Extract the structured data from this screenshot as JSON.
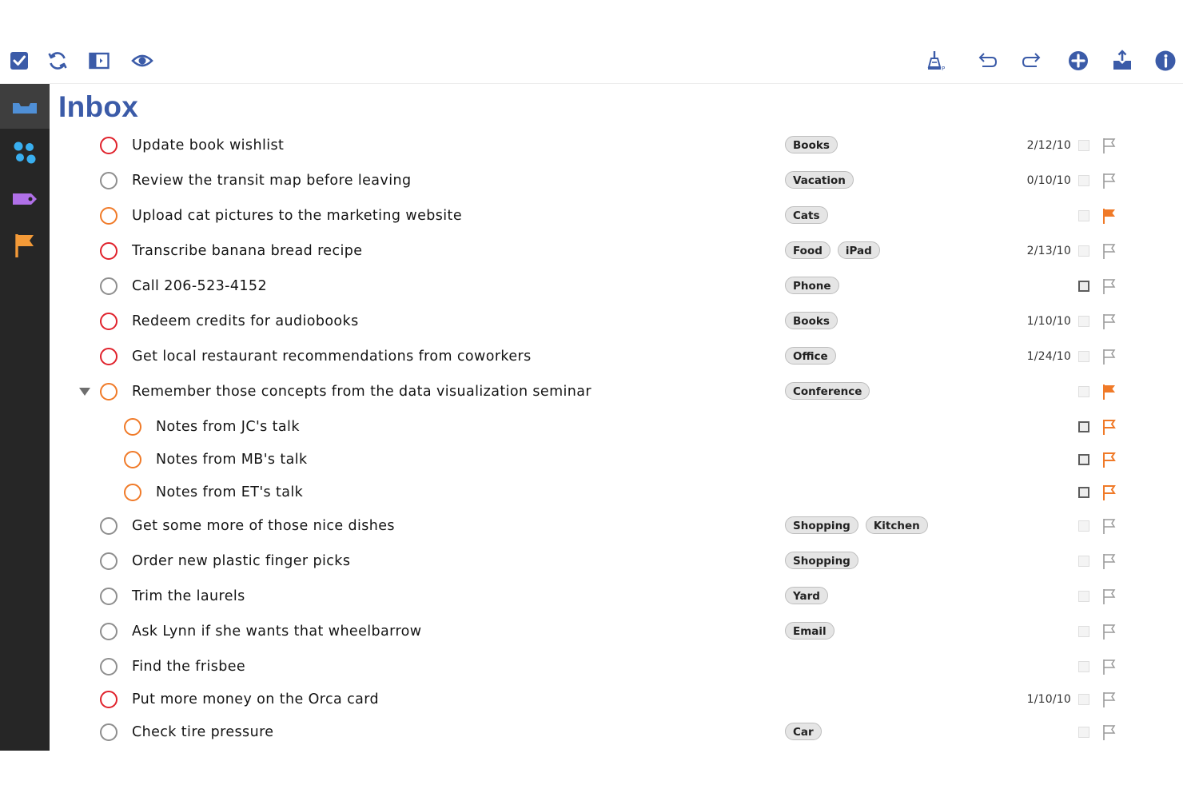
{
  "colors": {
    "accent": "#3b5ba8",
    "sidebar_bg": "#262626",
    "red": "#e0222c",
    "orange": "#f07a28",
    "gray": "#8e8e8e"
  },
  "toolbar": {
    "left_icons": [
      "checkbox-icon",
      "sync-icon",
      "sidebar-toggle-icon",
      "eye-icon"
    ],
    "right_icons": [
      "cleanup-icon",
      "undo-icon",
      "redo-icon",
      "add-icon",
      "share-icon",
      "info-icon"
    ]
  },
  "sidebar": {
    "items": [
      {
        "icon": "inbox-icon",
        "active": true
      },
      {
        "icon": "projects-icon",
        "active": false
      },
      {
        "icon": "tag-icon",
        "active": false
      },
      {
        "icon": "flag-icon",
        "active": false
      }
    ]
  },
  "main": {
    "title": "Inbox",
    "tasks": [
      {
        "text": "Update book wishlist",
        "status": "red",
        "tags": [
          "Books"
        ],
        "date": "2/12/10",
        "selector": "faint",
        "flag": "empty"
      },
      {
        "text": "Review the transit map before leaving",
        "status": "gray",
        "tags": [
          "Vacation"
        ],
        "date": "0/10/10",
        "selector": "faint",
        "flag": "empty"
      },
      {
        "text": "Upload cat pictures to the marketing website",
        "status": "orange",
        "tags": [
          "Cats"
        ],
        "date": "",
        "selector": "faint",
        "flag": "filled"
      },
      {
        "text": "Transcribe banana bread recipe",
        "status": "red",
        "tags": [
          "Food",
          "iPad"
        ],
        "date": "2/13/10",
        "selector": "faint",
        "flag": "empty"
      },
      {
        "text": "Call 206-523-4152",
        "status": "gray",
        "tags": [
          "Phone"
        ],
        "date": "",
        "selector": "dark",
        "flag": "empty"
      },
      {
        "text": "Redeem credits for audiobooks",
        "status": "red",
        "tags": [
          "Books"
        ],
        "date": "1/10/10",
        "selector": "faint",
        "flag": "empty"
      },
      {
        "text": "Get local restaurant recommendations from coworkers",
        "status": "red",
        "tags": [
          "Office"
        ],
        "date": "1/24/10",
        "selector": "faint",
        "flag": "empty"
      },
      {
        "text": "Remember those concepts from the data visualization seminar",
        "status": "orange",
        "tags": [
          "Conference"
        ],
        "date": "",
        "selector": "faint",
        "flag": "filled",
        "expanded": true
      },
      {
        "text": "Notes from JC's talk",
        "status": "orange",
        "tags": [],
        "date": "",
        "selector": "dark",
        "flag": "outline-orange",
        "child": true
      },
      {
        "text": "Notes from MB's talk",
        "status": "orange",
        "tags": [],
        "date": "",
        "selector": "dark",
        "flag": "outline-orange",
        "child": true
      },
      {
        "text": "Notes from ET's talk",
        "status": "orange",
        "tags": [],
        "date": "",
        "selector": "dark",
        "flag": "outline-orange",
        "child": true
      },
      {
        "text": "Get some more of those nice dishes",
        "status": "gray",
        "tags": [
          "Shopping",
          "Kitchen"
        ],
        "date": "",
        "selector": "faint",
        "flag": "empty"
      },
      {
        "text": "Order new plastic finger picks",
        "status": "gray",
        "tags": [
          "Shopping"
        ],
        "date": "",
        "selector": "faint",
        "flag": "empty"
      },
      {
        "text": "Trim the laurels",
        "status": "gray",
        "tags": [
          "Yard"
        ],
        "date": "",
        "selector": "faint",
        "flag": "empty"
      },
      {
        "text": "Ask Lynn if she wants that wheelbarrow",
        "status": "gray",
        "tags": [
          "Email"
        ],
        "date": "",
        "selector": "faint",
        "flag": "empty"
      },
      {
        "text": "Find the frisbee",
        "status": "gray",
        "tags": [],
        "date": "",
        "selector": "faint",
        "flag": "empty"
      },
      {
        "text": "Put more money on the Orca card",
        "status": "red",
        "tags": [],
        "date": "1/10/10",
        "selector": "faint",
        "flag": "empty"
      },
      {
        "text": "Check tire pressure",
        "status": "gray",
        "tags": [
          "Car"
        ],
        "date": "",
        "selector": "faint",
        "flag": "empty"
      }
    ]
  }
}
